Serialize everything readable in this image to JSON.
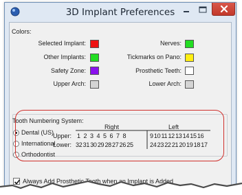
{
  "window": {
    "title": "3D Implant Preferences",
    "icon": "app-sphere-icon",
    "controls": {
      "minimize": "minimize-icon",
      "maximize": "maximize-icon",
      "close": "close-icon"
    }
  },
  "colors_section": {
    "heading": "Colors:",
    "left": [
      {
        "label": "Selected Implant:",
        "color": "#ee1111"
      },
      {
        "label": "Other  Implants:",
        "color": "#22dd22"
      },
      {
        "label": "Safety Zone:",
        "color": "#8a11ee"
      },
      {
        "label": "Upper Arch:",
        "color": "#d4d4d4"
      }
    ],
    "right": [
      {
        "label": "Nerves:",
        "color": "#22dd22"
      },
      {
        "label": "Tickmarks on Pano:",
        "color": "#ffee11"
      },
      {
        "label": "Prosthetic Teeth:",
        "color": "#ffffff"
      },
      {
        "label": "Lower Arch:",
        "color": "#d4d4d4"
      }
    ]
  },
  "tooth_numbering": {
    "heading": "Tooth Numbering System:",
    "options": [
      "Dental (US)",
      "International",
      "Orthodontist"
    ],
    "selected": "Dental (US)",
    "right_label": "Right",
    "left_label": "Left",
    "upper_label": "Upper:",
    "lower_label": "Lower:",
    "upper_right": "1 2 3 4 5 6 7 8",
    "upper_left": "9 10 11 12 13 14 15 16",
    "lower_right": "32 31 30 29 28 27 26 25",
    "lower_left": "24 23 22 21 20 19 18 17"
  },
  "prosthetic_checkbox": {
    "label": "Always Add Prosthetic Tooth when an Implant is Added",
    "checked": true
  },
  "accent_colors": {
    "highlight_outline": "#cf2f2b",
    "title_bar": "#dfe8f3",
    "close_button": "#c2392b"
  }
}
